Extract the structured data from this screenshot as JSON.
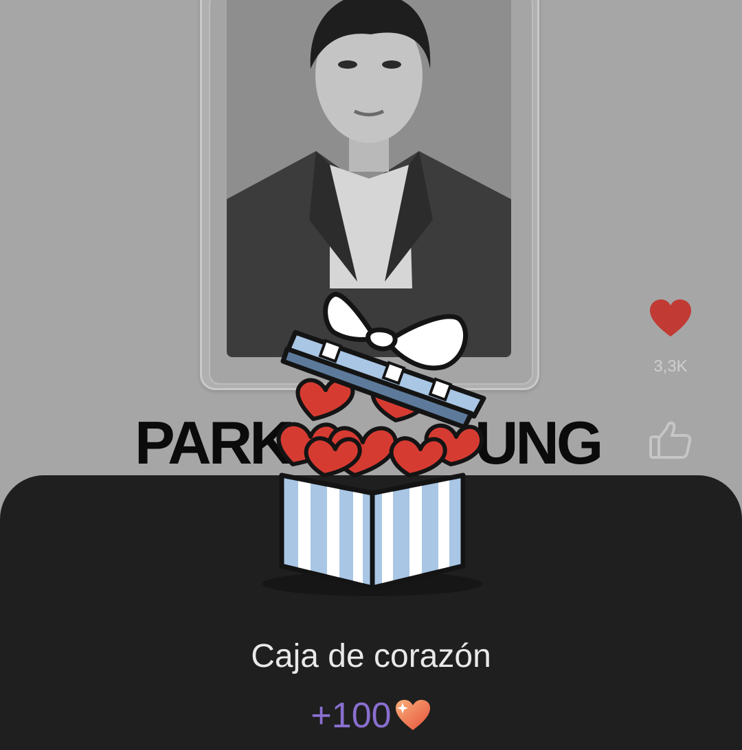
{
  "card": {
    "artist_name_left": "PARK",
    "artist_name_right": "UNG"
  },
  "actions": {
    "like_count": "3,3K"
  },
  "reward": {
    "title": "Caja de corazón",
    "amount": "+100",
    "currency_icon": "heart-icon"
  },
  "colors": {
    "sheet_bg": "#1f1f1f",
    "heart_red": "#c9302c",
    "box_blue": "#a9c6e4",
    "amount_purple": "#8a6fd0"
  }
}
